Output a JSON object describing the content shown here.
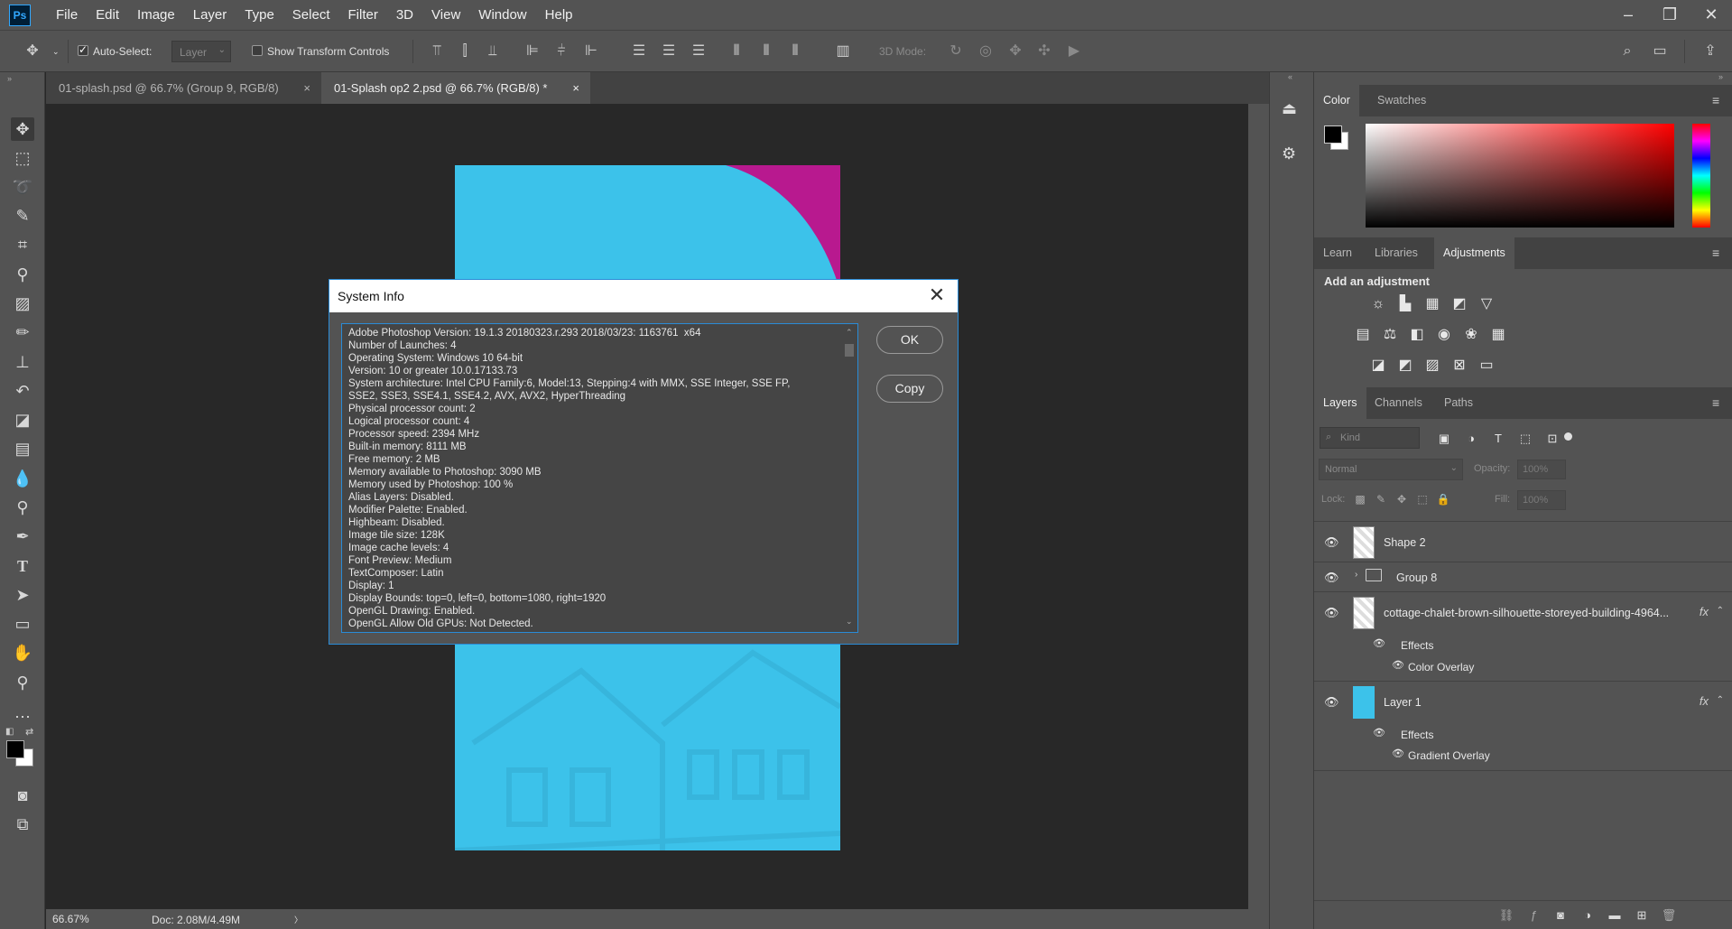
{
  "app": {
    "logo": "Ps"
  },
  "menu": [
    "File",
    "Edit",
    "Image",
    "Layer",
    "Type",
    "Select",
    "Filter",
    "3D",
    "View",
    "Window",
    "Help"
  ],
  "window_controls": {
    "minimize": "–",
    "restore": "❐",
    "close": "✕"
  },
  "options": {
    "auto_select_label": "Auto-Select:",
    "auto_select_value": "Layer",
    "show_transform_label": "Show Transform Controls",
    "mode_3d_label": "3D Mode:"
  },
  "tabs": [
    {
      "label": "01-splash.psd @ 66.7% (Group 9, RGB/8)",
      "close": "×"
    },
    {
      "label": "01-Splash op2 2.psd @ 66.7% (RGB/8) *",
      "close": "×"
    }
  ],
  "status": {
    "zoom": "66.67%",
    "doc": "Doc: 2.08M/4.49M",
    "arrow": "〉"
  },
  "dialog": {
    "title": "System Info",
    "close": "✕",
    "ok_label": "OK",
    "copy_label": "Copy",
    "lines": [
      "Adobe Photoshop Version: 19.1.3 20180323.r.293 2018/03/23: 1163761  x64",
      "Number of Launches: 4",
      "Operating System: Windows 10 64-bit",
      "Version: 10 or greater 10.0.17133.73",
      "System architecture: Intel CPU Family:6, Model:13, Stepping:4 with MMX, SSE Integer, SSE FP,",
      "SSE2, SSE3, SSE4.1, SSE4.2, AVX, AVX2, HyperThreading",
      "Physical processor count: 2",
      "Logical processor count: 4",
      "Processor speed: 2394 MHz",
      "Built-in memory: 8111 MB",
      "Free memory: 2 MB",
      "Memory available to Photoshop: 3090 MB",
      "Memory used by Photoshop: 100 %",
      "Alias Layers: Disabled.",
      "Modifier Palette: Enabled.",
      "Highbeam: Disabled.",
      "Image tile size: 128K",
      "Image cache levels: 4",
      "Font Preview: Medium",
      "TextComposer: Latin",
      "Display: 1",
      "Display Bounds: top=0, left=0, bottom=1080, right=1920",
      "OpenGL Drawing: Enabled.",
      "OpenGL Allow Old GPUs: Not Detected."
    ]
  },
  "color_panel": {
    "tabs": [
      "Color",
      "Swatches"
    ]
  },
  "adjust_panel": {
    "tabs": [
      "Learn",
      "Libraries",
      "Adjustments"
    ],
    "heading": "Add an adjustment"
  },
  "layers_panel": {
    "tabs": [
      "Layers",
      "Channels",
      "Paths"
    ],
    "kind_placeholder": "Kind",
    "blend_mode": "Normal",
    "opacity_label": "Opacity:",
    "opacity_value": "100%",
    "lock_label": "Lock:",
    "fill_label": "Fill:",
    "fill_value": "100%",
    "layers": [
      {
        "name": "Shape 2"
      },
      {
        "name": "Group 8"
      },
      {
        "name": "cottage-chalet-brown-silhouette-storeyed-building-4964...",
        "fx": "fx",
        "effects_label": "Effects",
        "effect": "Color Overlay"
      },
      {
        "name": "Layer 1",
        "fx": "fx",
        "effects_label": "Effects",
        "effect": "Gradient Overlay"
      }
    ]
  },
  "colors": {
    "canvas_blue": "#3cc2ea",
    "magenta": "#b8198f",
    "accent": "#2a8bd6"
  }
}
